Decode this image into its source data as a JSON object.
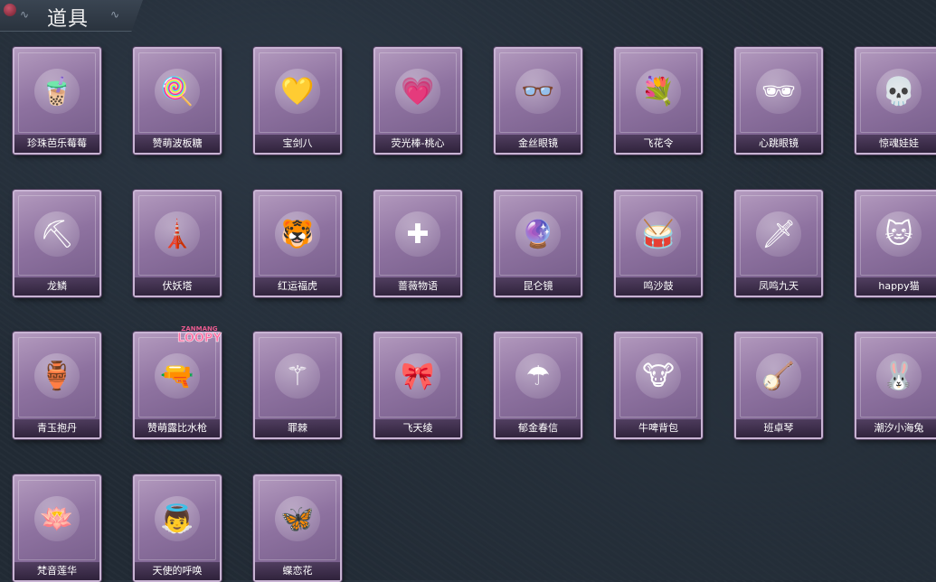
{
  "header": {
    "title": "道具"
  },
  "items": [
    {
      "label": "珍珠芭乐莓莓",
      "icon": "bottle-icon",
      "glyph": "🧋"
    },
    {
      "label": "赞萌波板糖",
      "icon": "lollipop-wand-icon",
      "glyph": "🍭"
    },
    {
      "label": "宝剑八",
      "icon": "heart-locket-icon",
      "glyph": "💛"
    },
    {
      "label": "荧光棒-桃心",
      "icon": "heart-wand-icon",
      "glyph": "💗"
    },
    {
      "label": "金丝眼镜",
      "icon": "glasses-icon",
      "glyph": "👓"
    },
    {
      "label": "飞花令",
      "icon": "flower-bouquet-icon",
      "glyph": "💐"
    },
    {
      "label": "心跳眼镜",
      "icon": "heart-glasses-icon",
      "glyph": "🕶"
    },
    {
      "label": "惊魂娃娃",
      "icon": "skull-doll-icon",
      "glyph": "💀"
    },
    {
      "label": "龙鳞",
      "icon": "shovel-icon",
      "glyph": "⛏"
    },
    {
      "label": "伏妖塔",
      "icon": "pagoda-icon",
      "glyph": "🗼"
    },
    {
      "label": "红运福虎",
      "icon": "tiger-icon",
      "glyph": "🐯"
    },
    {
      "label": "蔷薇物语",
      "icon": "first-aid-kit-icon",
      "glyph": "✚"
    },
    {
      "label": "昆仑镜",
      "icon": "mirror-icon",
      "glyph": "🔮"
    },
    {
      "label": "鸣沙鼓",
      "icon": "drum-icon",
      "glyph": "🥁"
    },
    {
      "label": "凤鸣九天",
      "icon": "sword-icon",
      "glyph": "🗡"
    },
    {
      "label": "happy猫",
      "icon": "cat-icon",
      "glyph": "🐱"
    },
    {
      "label": "青玉抱丹",
      "icon": "vase-icon",
      "glyph": "🏺"
    },
    {
      "label": "赞萌露比水枪",
      "icon": "water-gun-icon",
      "glyph": "🔫"
    },
    {
      "label": "罪棘",
      "icon": "staff-icon",
      "glyph": "⚚"
    },
    {
      "label": "飞天绫",
      "icon": "ribbon-icon",
      "glyph": "🎀"
    },
    {
      "label": "郁金春信",
      "icon": "umbrella-icon",
      "glyph": "☂"
    },
    {
      "label": "牛啤背包",
      "icon": "cow-backpack-icon",
      "glyph": "🐮"
    },
    {
      "label": "班卓琴",
      "icon": "banjo-beaver-icon",
      "glyph": "🪕"
    },
    {
      "label": "潮汐小海兔",
      "icon": "sea-rabbit-icon",
      "glyph": "🐰"
    },
    {
      "label": "梵音莲华",
      "icon": "lotus-doll-icon",
      "glyph": "🪷"
    },
    {
      "label": "天使的呼唤",
      "icon": "angel-icon",
      "glyph": "👼"
    },
    {
      "label": "蝶恋花",
      "icon": "butterfly-chime-icon",
      "glyph": "🦋"
    }
  ],
  "overlay_badge": {
    "line1": "ZANMANG",
    "line2": "LOOPY"
  }
}
